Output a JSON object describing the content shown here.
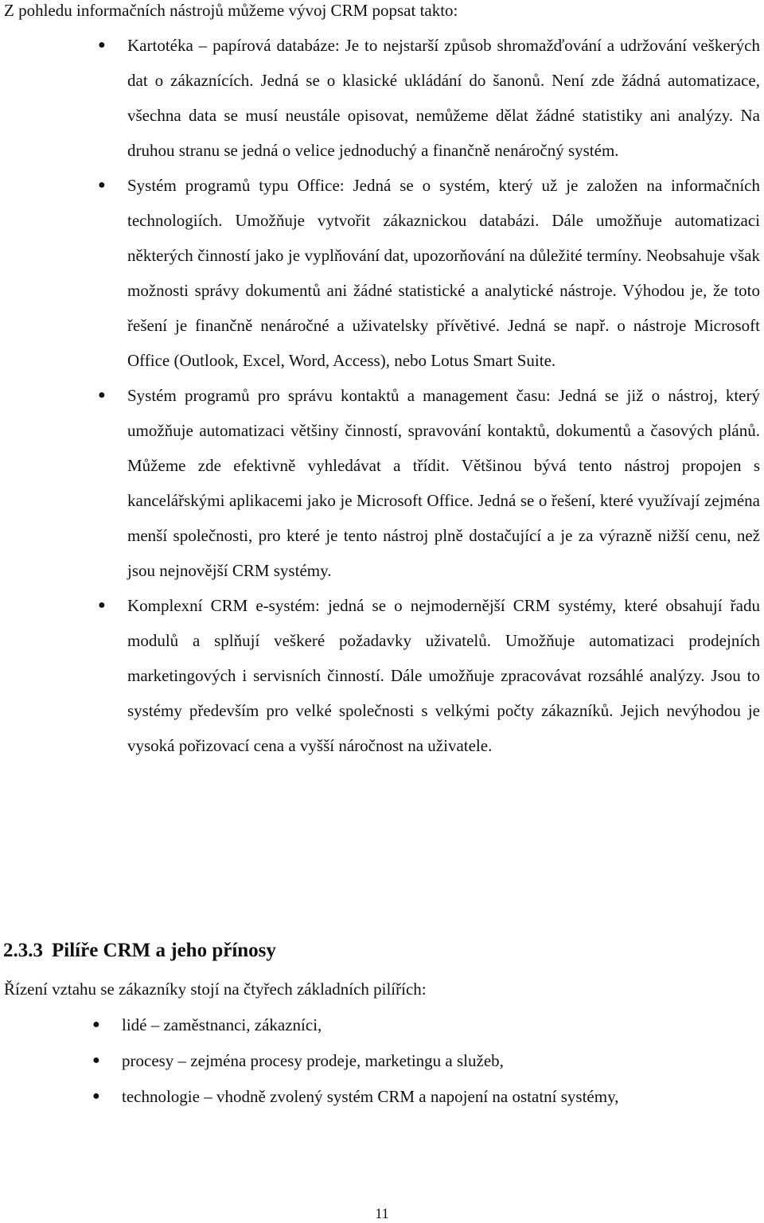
{
  "intro": "Z pohledu informačních nástrojů můžeme vývoj CRM popsat takto:",
  "crm_tools": [
    "Kartotéka – papírová databáze: Je to nejstarší způsob shromažďování a udržování veškerých dat o zákaznících. Jedná se o klasické ukládání do šanonů. Není zde žádná automatizace, všechna data se musí neustále opisovat, nemůžeme dělat žádné statistiky ani analýzy. Na druhou stranu se jedná o velice jednoduchý a finančně nenáročný systém.",
    "Systém programů typu Office: Jedná se o systém, který už je založen na informačních technologiích. Umožňuje vytvořit zákaznickou databázi. Dále umožňuje automatizaci některých činností jako je vyplňování dat, upozorňování na důležité termíny. Neobsahuje však možnosti správy dokumentů ani žádné statistické a analytické nástroje. Výhodou je, že toto řešení je finančně nenáročné a uživatelsky přívětivé. Jedná se např. o nástroje Microsoft Office (Outlook, Excel, Word, Access), nebo Lotus Smart Suite.",
    "Systém programů pro správu kontaktů a management času: Jedná se již o nástroj, který umožňuje automatizaci většiny činností, spravování kontaktů, dokumentů a časových plánů. Můžeme zde efektivně vyhledávat a třídit. Většinou bývá tento nástroj propojen s kancelářskými aplikacemi jako je Microsoft Office. Jedná se o řešení, které využívají zejména menší společnosti, pro které je tento nástroj plně dostačující a je za výrazně nižší cenu, než jsou nejnovější CRM systémy.",
    "Komplexní CRM e-systém: jedná se o nejmodernější CRM systémy, které obsahují řadu modulů a splňují veškeré požadavky uživatelů. Umožňuje automatizaci prodejních marketingových i servisních činností. Dále umožňuje zpracovávat rozsáhlé analýzy. Jsou to systémy především pro velké společnosti s velkými počty zákazníků. Jejich nevýhodou je vysoká pořizovací cena a vyšší náročnost na uživatele."
  ],
  "section": {
    "number": "2.3.3",
    "title": "Pilíře CRM a jeho přínosy"
  },
  "pillars_intro": "Řízení vztahu se zákazníky stojí na čtyřech základních pilířích:",
  "pillars": [
    "lidé – zaměstnanci, zákazníci,",
    "procesy – zejména procesy prodeje, marketingu a služeb,",
    "technologie – vhodně zvolený systém CRM a napojení na ostatní systémy,"
  ],
  "bullet_glyph": "●",
  "page_number": "11"
}
